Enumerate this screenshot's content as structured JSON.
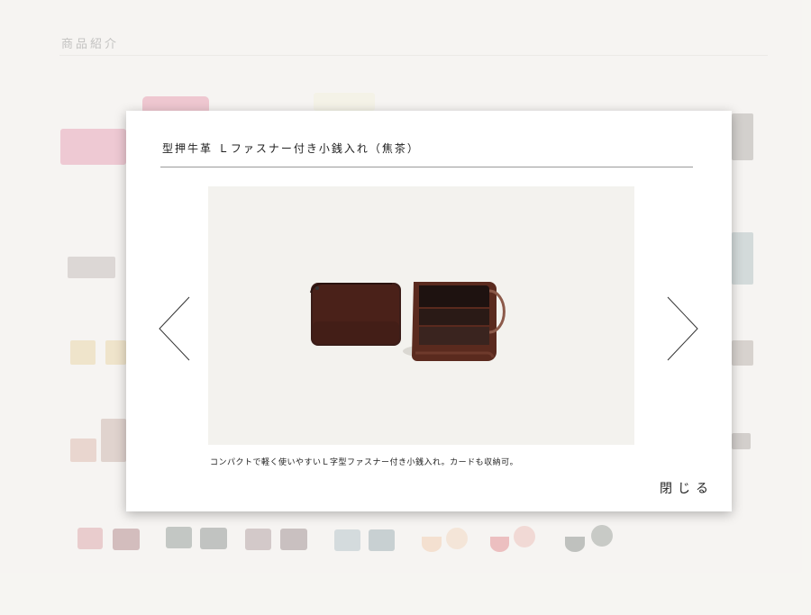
{
  "page": {
    "section_title": "商品紹介"
  },
  "modal": {
    "title": "型押牛革 Ｌファスナー付き小銭入れ（焦茶）",
    "caption": "コンパクトで軽く使いやすいＬ字型ファスナー付き小銭入れ。カードも収納可。",
    "close_label": "閉じる",
    "prev_icon": "chevron-left-icon",
    "next_icon": "chevron-right-icon"
  },
  "colors": {
    "background": "#f6f5f2",
    "modal_background": "#ffffff",
    "photo_background": "#f3f2ee",
    "wallet_brown": "#4a2119"
  }
}
